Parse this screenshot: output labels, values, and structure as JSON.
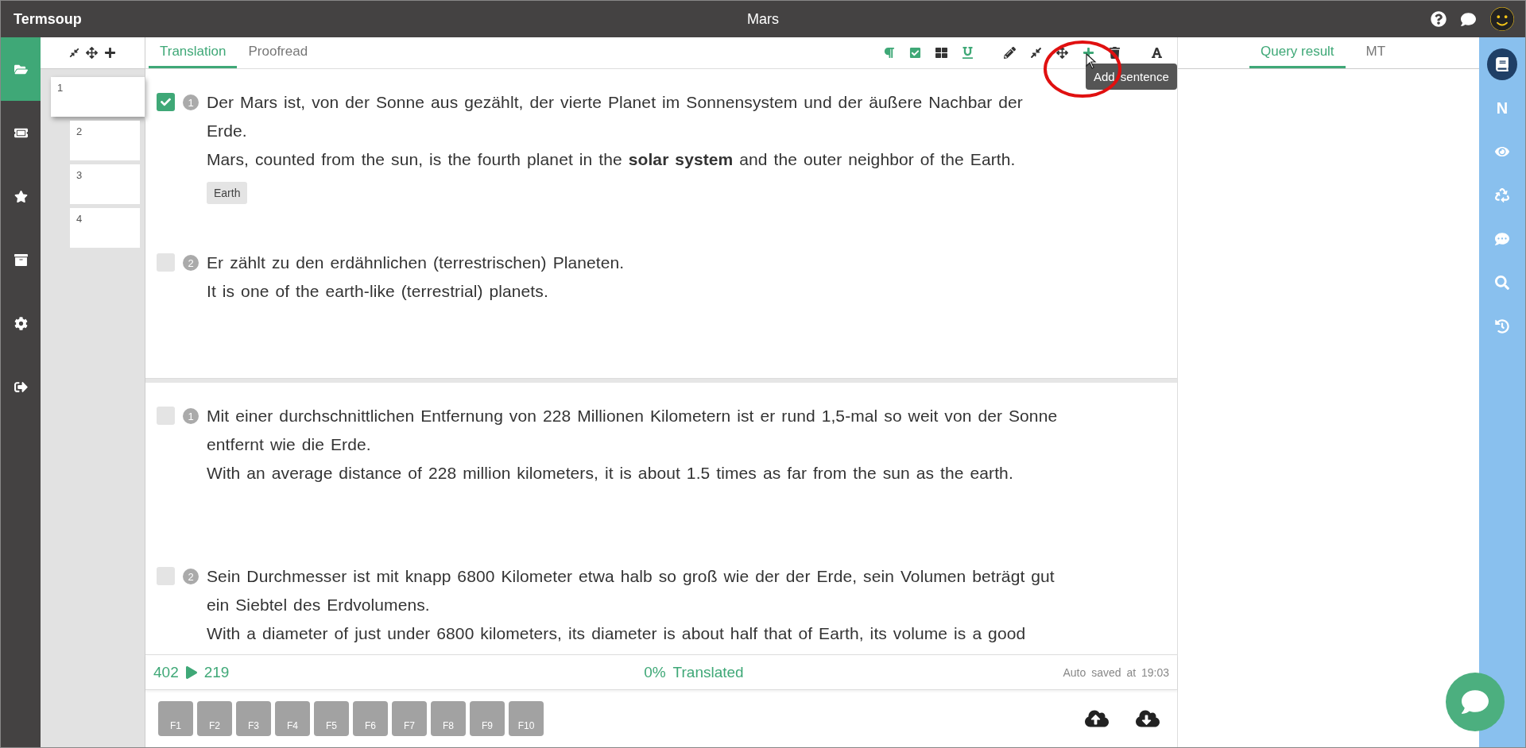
{
  "app": {
    "name": "Termsoup"
  },
  "document": {
    "title": "Mars"
  },
  "nav_items": [
    {
      "selected": true
    },
    {
      "selected": false
    },
    {
      "selected": false
    },
    {
      "selected": false
    },
    {
      "selected": false
    },
    {
      "selected": false
    }
  ],
  "page_list": {
    "pages": [
      {
        "label": "1",
        "selected": true
      },
      {
        "label": "2",
        "selected": false
      },
      {
        "label": "3",
        "selected": false
      },
      {
        "label": "4",
        "selected": false
      }
    ]
  },
  "editor": {
    "tabs": [
      {
        "label": "Translation",
        "selected": true
      },
      {
        "label": "Proofread",
        "selected": false
      }
    ],
    "tooltip": "Add sentence",
    "blocks": [
      {
        "sentences": [
          {
            "number": "1",
            "checked": true,
            "source": "Der Mars ist, von der Sonne aus gezählt, der vierte Planet im Sonnensystem und der äußere Nachbar der Erde.",
            "target": "Mars, counted from the sun, is the fourth planet in the **solar system** and the outer neighbor of the Earth.",
            "tags": [
              "Earth"
            ]
          },
          {
            "number": "2",
            "checked": false,
            "source": "Er zählt zu den erdähnlichen (terrestrischen) Planeten.",
            "target": "It is one of the earth-like (terrestrial) planets."
          }
        ]
      },
      {
        "sentences": [
          {
            "number": "1",
            "checked": false,
            "source": "Mit einer durchschnittlichen Entfernung von 228 Millionen Kilometern ist er rund 1,5-mal so weit von der Sonne entfernt wie die Erde.",
            "target": "With an average distance of 228 million kilometers, it is about 1.5 times as far from the sun as the earth."
          },
          {
            "number": "2",
            "checked": false,
            "source": "Sein Durchmesser ist mit knapp 6800 Kilometer etwa halb so groß wie der der Erde, sein Volumen beträgt gut ein Siebtel des Erdvolumens.",
            "target": "With a diameter of just under 6800 kilometers, its diameter is about half that of Earth, its volume is a good"
          }
        ]
      }
    ],
    "status": {
      "source_count": "402",
      "target_count": "219",
      "progress": "0%",
      "progress_label": "Translated",
      "saved": "Auto saved at 19:03"
    },
    "function_keys": [
      "F1",
      "F2",
      "F3",
      "F4",
      "F5",
      "F6",
      "F7",
      "F8",
      "F9",
      "F10"
    ]
  },
  "side_panel": {
    "tabs": [
      {
        "label": "Query result",
        "selected": true
      },
      {
        "label": "MT",
        "selected": false
      }
    ]
  },
  "tools": [
    {
      "selected": true
    },
    {
      "label": "N",
      "selected": false
    },
    {
      "selected": false
    },
    {
      "selected": false
    },
    {
      "selected": false
    },
    {
      "selected": false
    },
    {
      "selected": false
    }
  ]
}
